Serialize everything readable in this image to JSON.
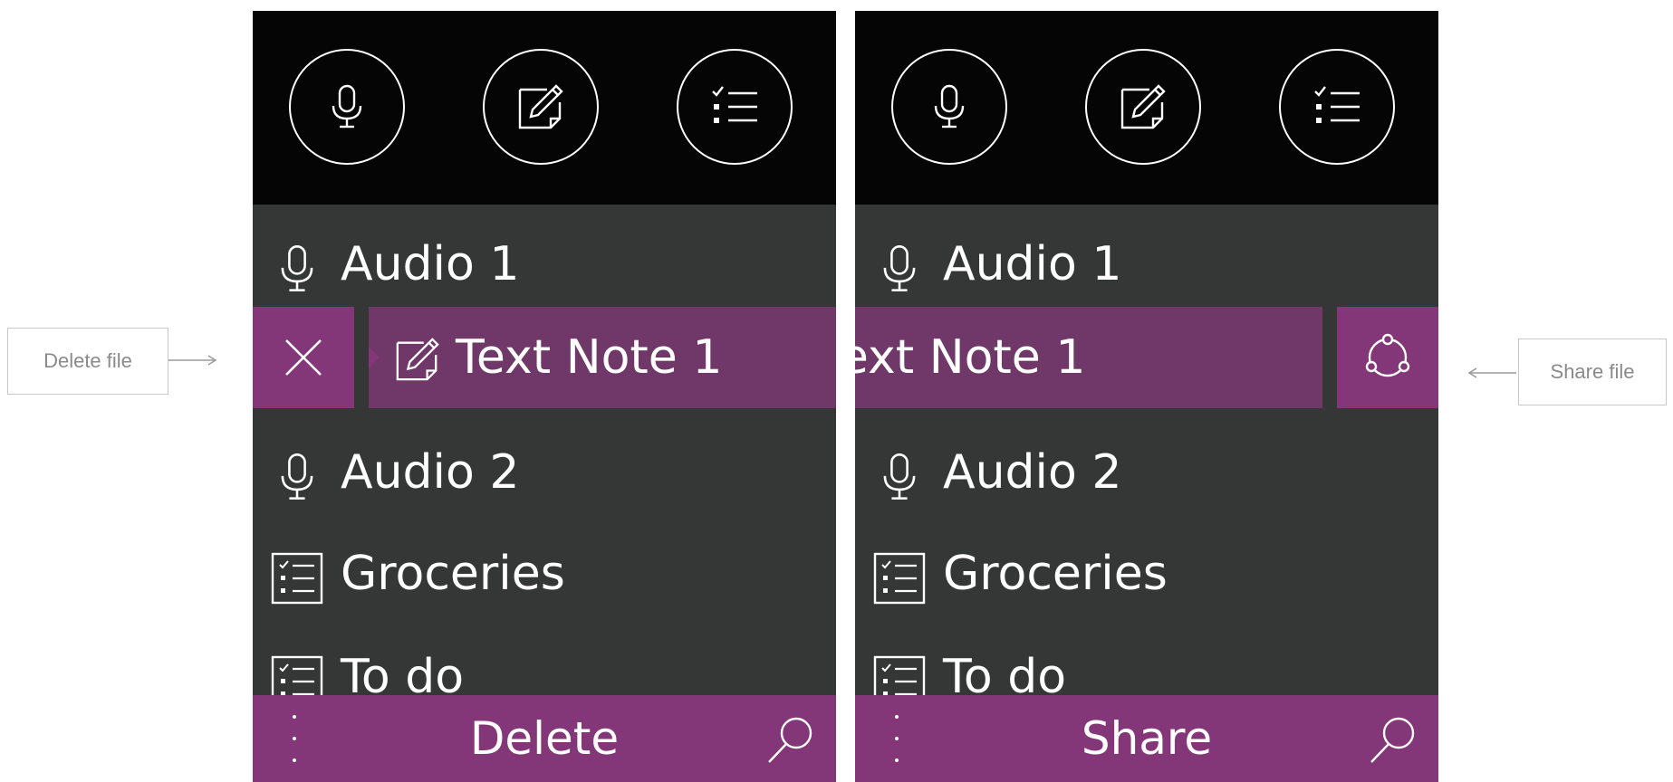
{
  "quick_actions": [
    {
      "icon": "microphone-icon"
    },
    {
      "icon": "note-pencil-icon"
    },
    {
      "icon": "checklist-icon"
    }
  ],
  "items": [
    {
      "label": "Audio 1",
      "icon": "microphone-icon"
    },
    {
      "label": "Text Note 1",
      "icon": "note-pencil-icon"
    },
    {
      "label": "Audio 2",
      "icon": "microphone-icon"
    },
    {
      "label": "Groceries",
      "icon": "checklist-icon"
    },
    {
      "label": "To do",
      "icon": "checklist-icon"
    }
  ],
  "left_panel": {
    "app_bar_title": "Delete",
    "swipe_action_icon": "close-icon"
  },
  "right_panel": {
    "app_bar_title": "Share",
    "swipe_action_icon": "share-icon"
  },
  "callouts": {
    "delete": "Delete file",
    "share": "Share file"
  },
  "colors": {
    "accent": "#843778",
    "swiped_item": "#6f3868",
    "list_bg": "#353636",
    "header_bg": "#050505"
  }
}
